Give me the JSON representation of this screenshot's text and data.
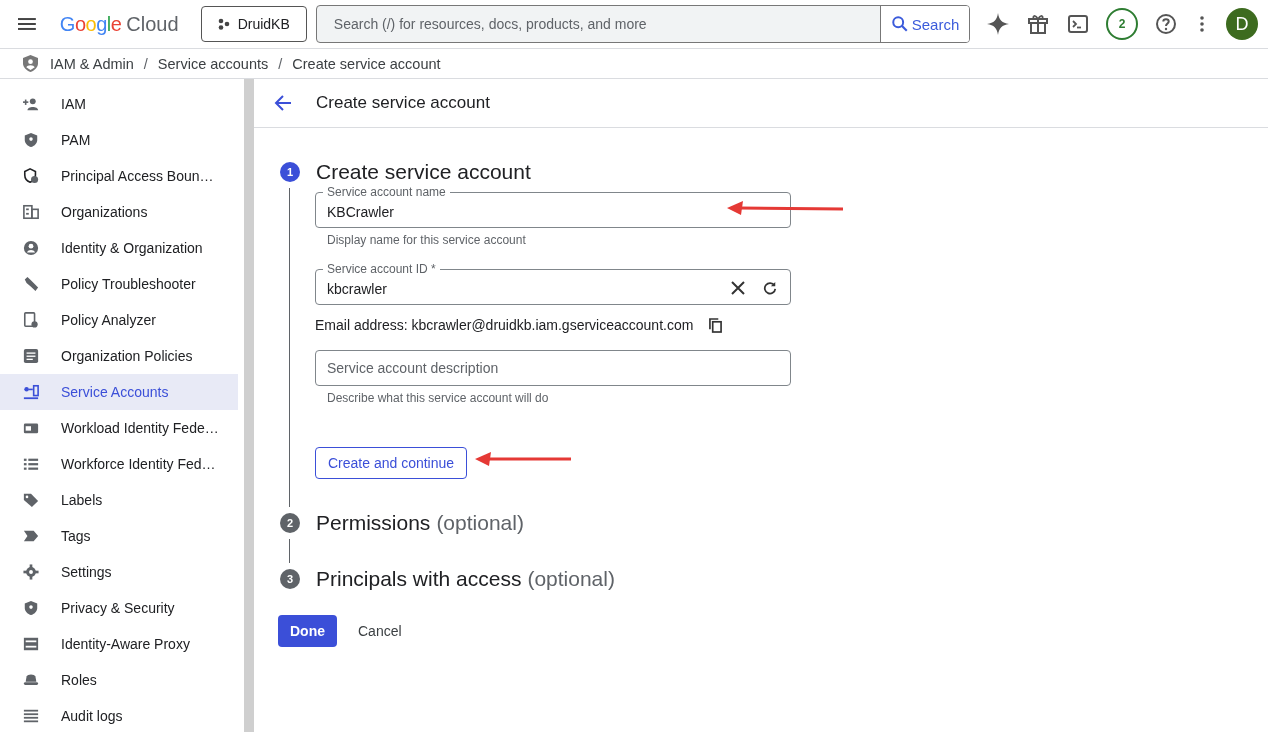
{
  "header": {
    "logo_brand": "Google",
    "logo_product": "Cloud",
    "project": "DruidKB",
    "search_placeholder": "Search (/) for resources, docs, products, and more",
    "search_button": "Search",
    "notification_count": "2",
    "avatar_initial": "D"
  },
  "breadcrumbs": {
    "separator": "/",
    "items": [
      "IAM & Admin",
      "Service accounts",
      "Create service account"
    ]
  },
  "sidebar": {
    "items": [
      {
        "label": "IAM",
        "selected": false
      },
      {
        "label": "PAM",
        "selected": false
      },
      {
        "label": "Principal Access Boun…",
        "selected": false
      },
      {
        "label": "Organizations",
        "selected": false
      },
      {
        "label": "Identity & Organization",
        "selected": false
      },
      {
        "label": "Policy Troubleshooter",
        "selected": false
      },
      {
        "label": "Policy Analyzer",
        "selected": false
      },
      {
        "label": "Organization Policies",
        "selected": false
      },
      {
        "label": "Service Accounts",
        "selected": true
      },
      {
        "label": "Workload Identity Fede…",
        "selected": false
      },
      {
        "label": "Workforce Identity Fed…",
        "selected": false
      },
      {
        "label": "Labels",
        "selected": false
      },
      {
        "label": "Tags",
        "selected": false
      },
      {
        "label": "Settings",
        "selected": false
      },
      {
        "label": "Privacy & Security",
        "selected": false
      },
      {
        "label": "Identity-Aware Proxy",
        "selected": false
      },
      {
        "label": "Roles",
        "selected": false
      },
      {
        "label": "Audit logs",
        "selected": false
      }
    ]
  },
  "page_title": "Create service account",
  "steps": [
    {
      "number": "1",
      "title": "Create service account",
      "selected": true
    },
    {
      "number": "2",
      "title": "Permissions",
      "optional": "(optional)",
      "selected": false
    },
    {
      "number": "3",
      "title": "Principals with access",
      "optional": "(optional)",
      "selected": false
    }
  ],
  "form": {
    "name_field": {
      "label": "Service account name",
      "value": "KBCrawler",
      "help": "Display name for this service account"
    },
    "id_field": {
      "label": "Service account ID *",
      "value": "kbcrawler"
    },
    "email": "Email address: kbcrawler@druidkb.iam.gserviceaccount.com",
    "description_field": {
      "placeholder": "Service account description",
      "help": "Describe what this service account will do"
    },
    "continue_button": "Create and continue"
  },
  "actions": {
    "done": "Done",
    "cancel": "Cancel"
  }
}
